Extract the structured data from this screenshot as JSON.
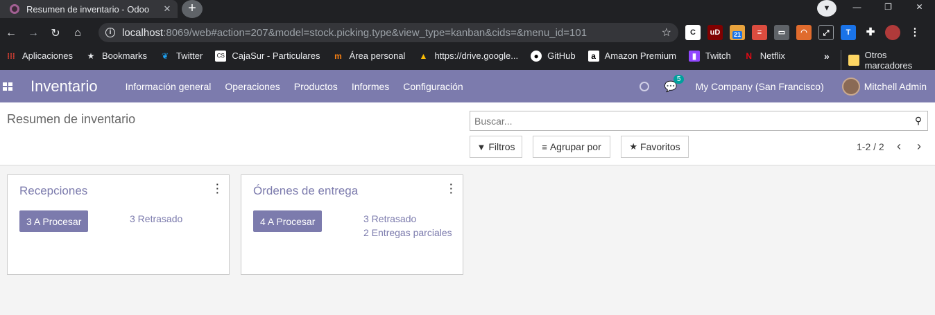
{
  "browser": {
    "tab_title": "Resumen de inventario - Odoo",
    "url_host": "localhost",
    "url_rest": ":8069/web#action=207&model=stock.picking.type&view_type=kanban&cids=&menu_id=101",
    "extension_badge": "21",
    "bookmarks": [
      {
        "label": "Aplicaciones",
        "icon": "apps-grid-icon"
      },
      {
        "label": "Bookmarks",
        "icon": "star-icon"
      },
      {
        "label": "Twitter",
        "icon": "twitter-icon"
      },
      {
        "label": "CajaSur - Particulares",
        "icon": "cajasur-icon"
      },
      {
        "label": "Área personal",
        "icon": "moodle-icon"
      },
      {
        "label": "https://drive.google...",
        "icon": "drive-icon"
      },
      {
        "label": "GitHub",
        "icon": "github-icon"
      },
      {
        "label": "Amazon Premium",
        "icon": "amazon-icon"
      },
      {
        "label": "Twitch",
        "icon": "twitch-icon"
      },
      {
        "label": "Netflix",
        "icon": "netflix-icon"
      }
    ],
    "overflow": "»",
    "other_bookmarks": "Otros marcadores"
  },
  "app": {
    "brand": "Inventario",
    "menu": [
      "Información general",
      "Operaciones",
      "Productos",
      "Informes",
      "Configuración"
    ],
    "chat_count": "5",
    "company": "My Company (San Francisco)",
    "user": "Mitchell Admin"
  },
  "control_panel": {
    "title": "Resumen de inventario",
    "search_placeholder": "Buscar...",
    "filters": "Filtros",
    "group_by": "Agrupar por",
    "favorites": "Favoritos",
    "pager": "1-2 / 2"
  },
  "cards": [
    {
      "title": "Recepciones",
      "button": "3 A Procesar",
      "links": [
        "3 Retrasado"
      ]
    },
    {
      "title": "Órdenes de entrega",
      "button": "4 A Procesar",
      "links": [
        "3 Retrasado",
        "2 Entregas parciales"
      ]
    }
  ],
  "colors": {
    "brand": "#7c7bad",
    "badge": "#00a09d"
  }
}
